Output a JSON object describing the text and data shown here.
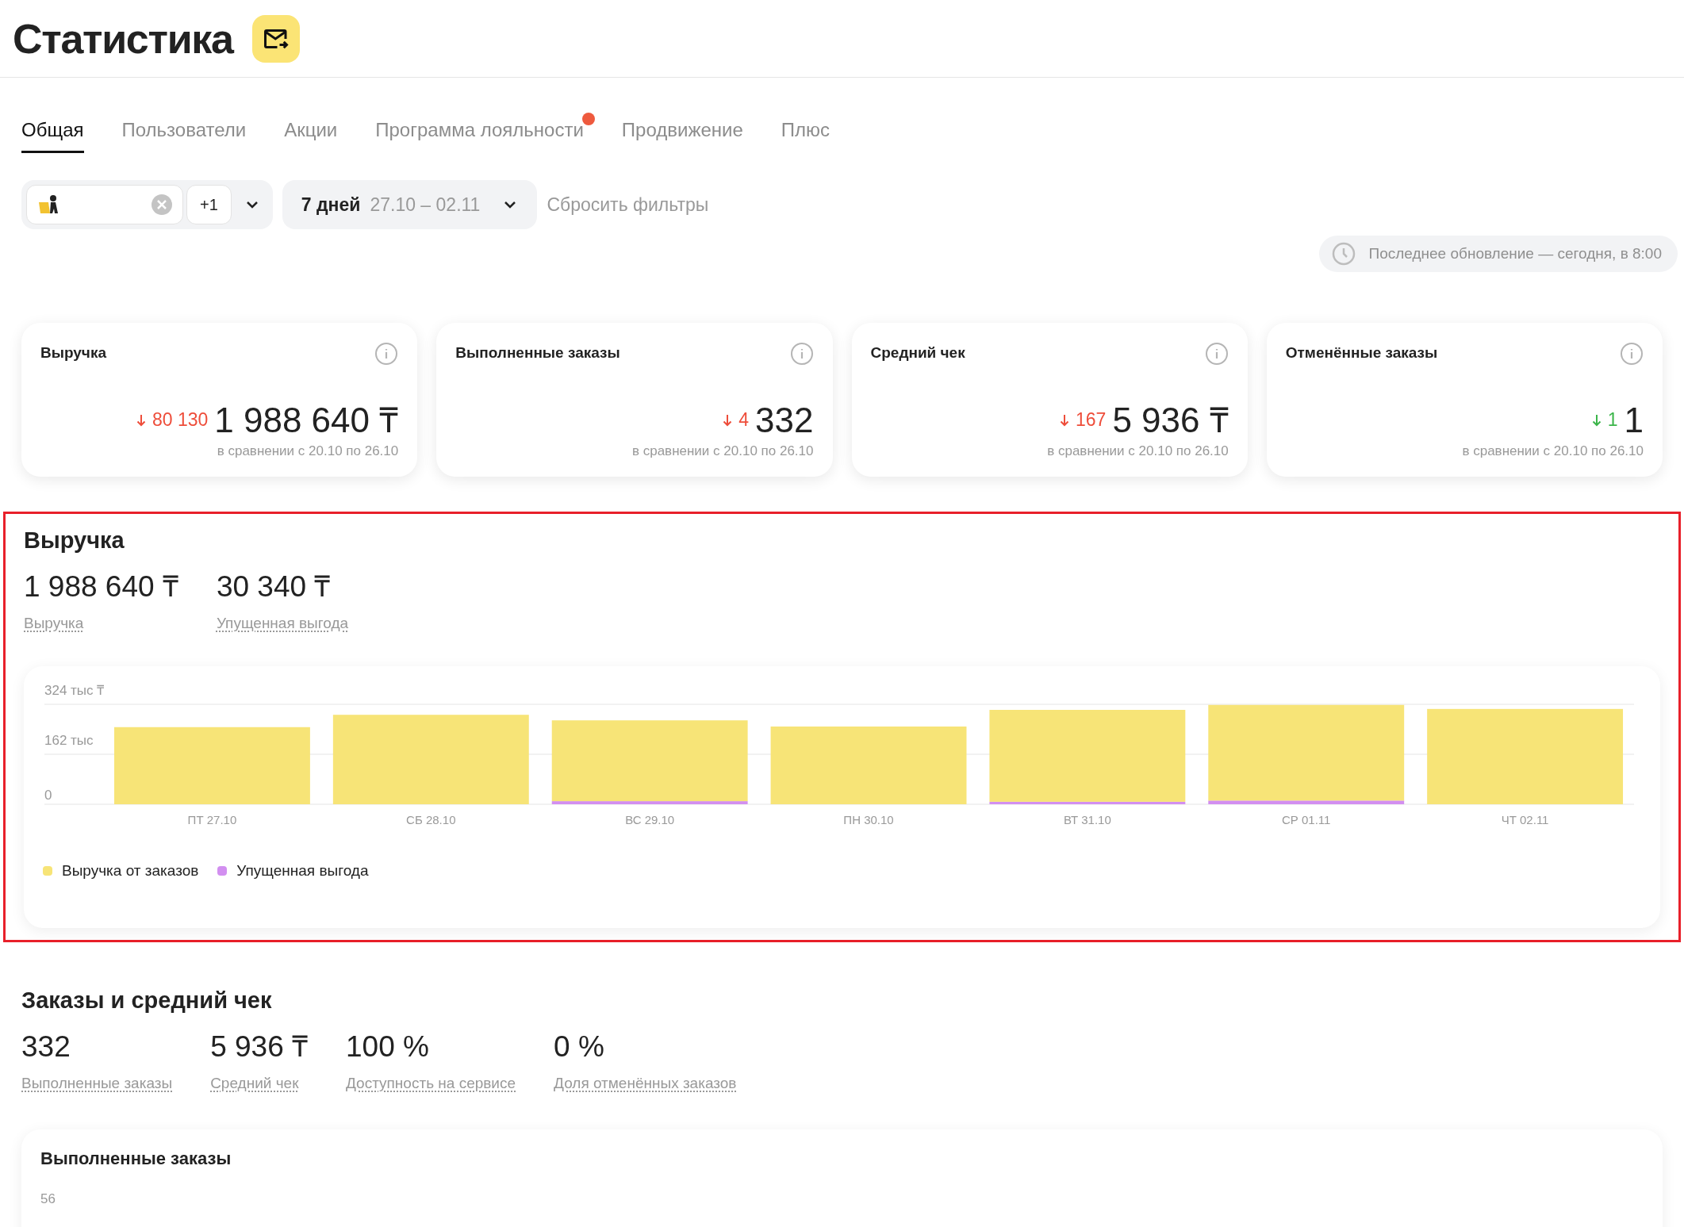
{
  "header": {
    "title": "Статистика"
  },
  "tabs": [
    {
      "label": "Общая",
      "selected": true,
      "badge": false
    },
    {
      "label": "Пользователи",
      "selected": false,
      "badge": false
    },
    {
      "label": "Акции",
      "selected": false,
      "badge": false
    },
    {
      "label": "Программа лояльности",
      "selected": false,
      "badge": true
    },
    {
      "label": "Продвижение",
      "selected": false,
      "badge": false
    },
    {
      "label": "Плюс",
      "selected": false,
      "badge": false
    }
  ],
  "filters": {
    "store_extra": "+1",
    "period_label": "7 дней",
    "period_dates": "27.10 – 02.11",
    "reset": "Сбросить фильтры"
  },
  "last_update": "Последнее обновление — сегодня, в 8:00",
  "cards": [
    {
      "title": "Выручка",
      "delta": "80 130",
      "decrease": true,
      "good": false,
      "value": "1 988 640 ₸",
      "note": "в сравнении с 20.10 по 26.10"
    },
    {
      "title": "Выполненные заказы",
      "delta": "4",
      "decrease": true,
      "good": false,
      "value": "332",
      "note": "в сравнении с 20.10 по 26.10"
    },
    {
      "title": "Средний чек",
      "delta": "167",
      "decrease": true,
      "good": false,
      "value": "5 936 ₸",
      "note": "в сравнении с 20.10 по 26.10"
    },
    {
      "title": "Отменённые заказы",
      "delta": "1",
      "decrease": true,
      "good": true,
      "value": "1",
      "note": "в сравнении с 20.10 по 26.10"
    }
  ],
  "revenue": {
    "title": "Выручка",
    "metrics": [
      {
        "value": "1 988 640 ₸",
        "label": "Выручка"
      },
      {
        "value": "30 340 ₸",
        "label": "Упущенная выгода"
      }
    ],
    "chart_data": {
      "type": "bar",
      "stacked": true,
      "categories": [
        "ПТ 27.10",
        "СБ 28.10",
        "ВС 29.10",
        "ПН 30.10",
        "ВТ 31.10",
        "СР 01.11",
        "ЧТ 02.11"
      ],
      "ylim": [
        0,
        324
      ],
      "yticks": [
        {
          "value": 0,
          "label": "0"
        },
        {
          "value": 162,
          "label": "162 тыс"
        },
        {
          "value": 324,
          "label": "324 тыс ₸"
        }
      ],
      "series": [
        {
          "name": "Выручка от заказов",
          "color": "#f7e477",
          "values": [
            250,
            290,
            262,
            252,
            298,
            310,
            309
          ]
        },
        {
          "name": "Упущенная выгода",
          "color": "#d28ff0",
          "values": [
            0,
            0,
            10,
            0,
            8,
            12,
            0
          ]
        }
      ]
    }
  },
  "orders": {
    "title": "Заказы и средний чек",
    "metrics": [
      {
        "value": "332",
        "label": "Выполненные заказы"
      },
      {
        "value": "5 936 ₸",
        "label": "Средний чек"
      },
      {
        "value": "100 %",
        "label": "Доступность на сервисе"
      },
      {
        "value": "0 %",
        "label": "Доля отменённых заказов"
      }
    ],
    "card_title": "Выполненные заказы",
    "first_tick": "56"
  }
}
